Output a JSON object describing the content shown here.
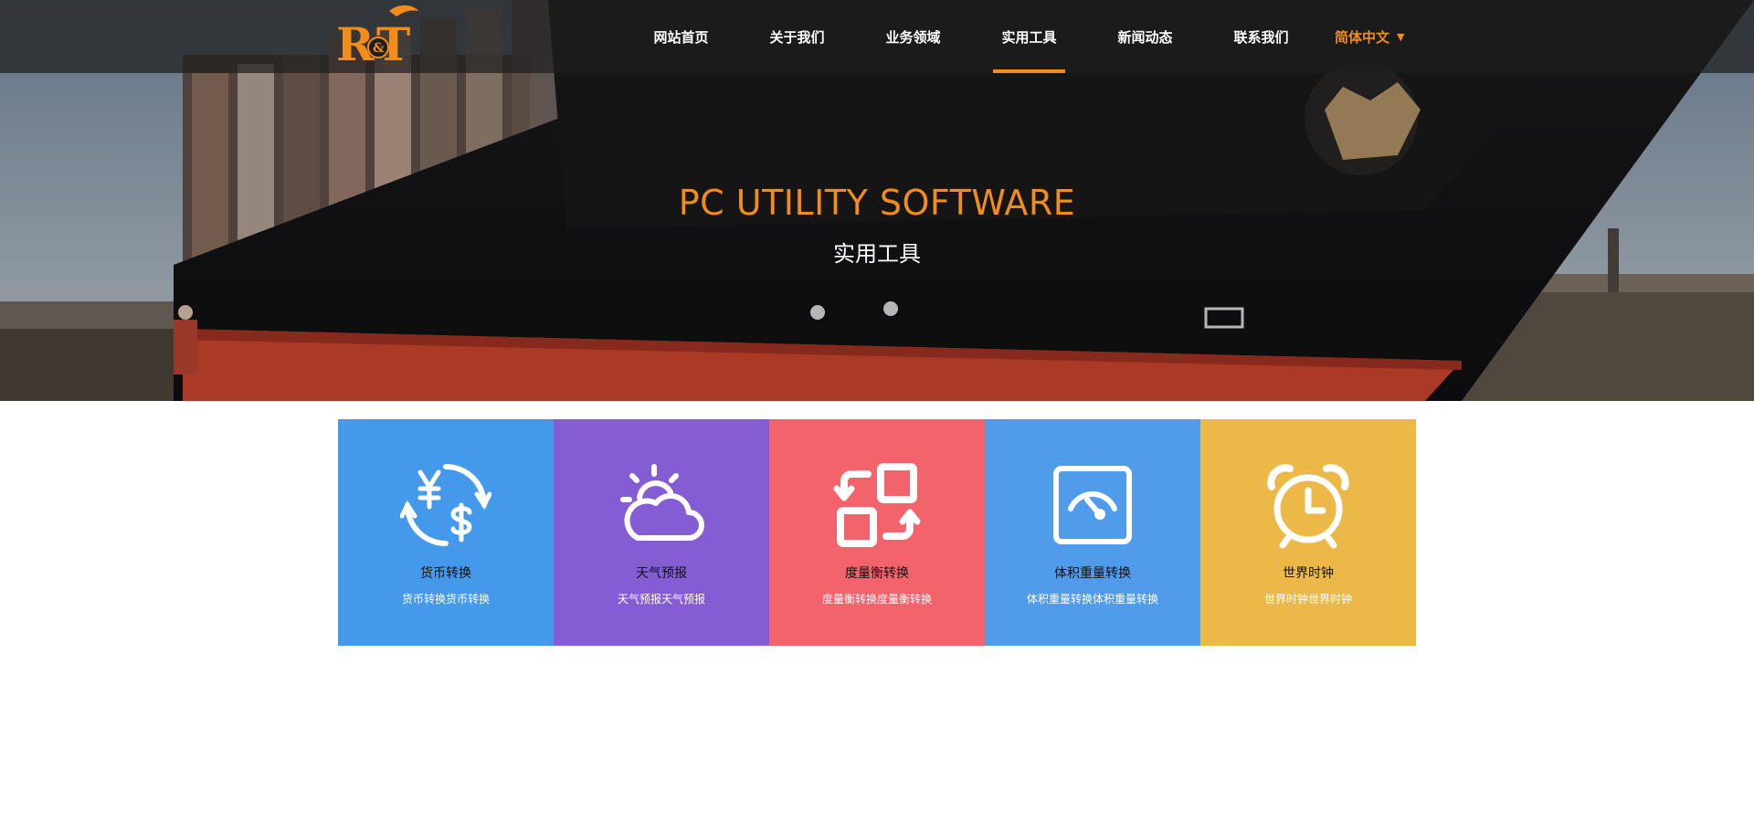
{
  "nav": {
    "items": [
      {
        "label": "网站首页"
      },
      {
        "label": "关于我们"
      },
      {
        "label": "业务领域"
      },
      {
        "label": "实用工具"
      },
      {
        "label": "新闻动态"
      },
      {
        "label": "联系我们"
      }
    ],
    "active_index": 3,
    "language": "简体中文"
  },
  "hero": {
    "title": "PC UTILITY SOFTWARE",
    "subtitle": "实用工具"
  },
  "tools": [
    {
      "name": "货币转换",
      "desc": "货币转换货币转换",
      "color": "#4499ea",
      "icon": "currency-exchange-icon"
    },
    {
      "name": "天气预报",
      "desc": "天气预报天气预报",
      "color": "#845dd4",
      "icon": "weather-icon"
    },
    {
      "name": "度量衡转换",
      "desc": "度量衡转换度量衡转换",
      "color": "#f2636c",
      "icon": "measure-convert-icon"
    },
    {
      "name": "体积重量转换",
      "desc": "体积重量转换体积重量转换",
      "color": "#519beb",
      "icon": "gauge-icon"
    },
    {
      "name": "世界时钟",
      "desc": "世界时钟世界时钟",
      "color": "#ecb847",
      "icon": "alarm-clock-icon"
    }
  ],
  "colors": {
    "accent": "#f28c1a",
    "header_bg": "#1e1e1e"
  }
}
